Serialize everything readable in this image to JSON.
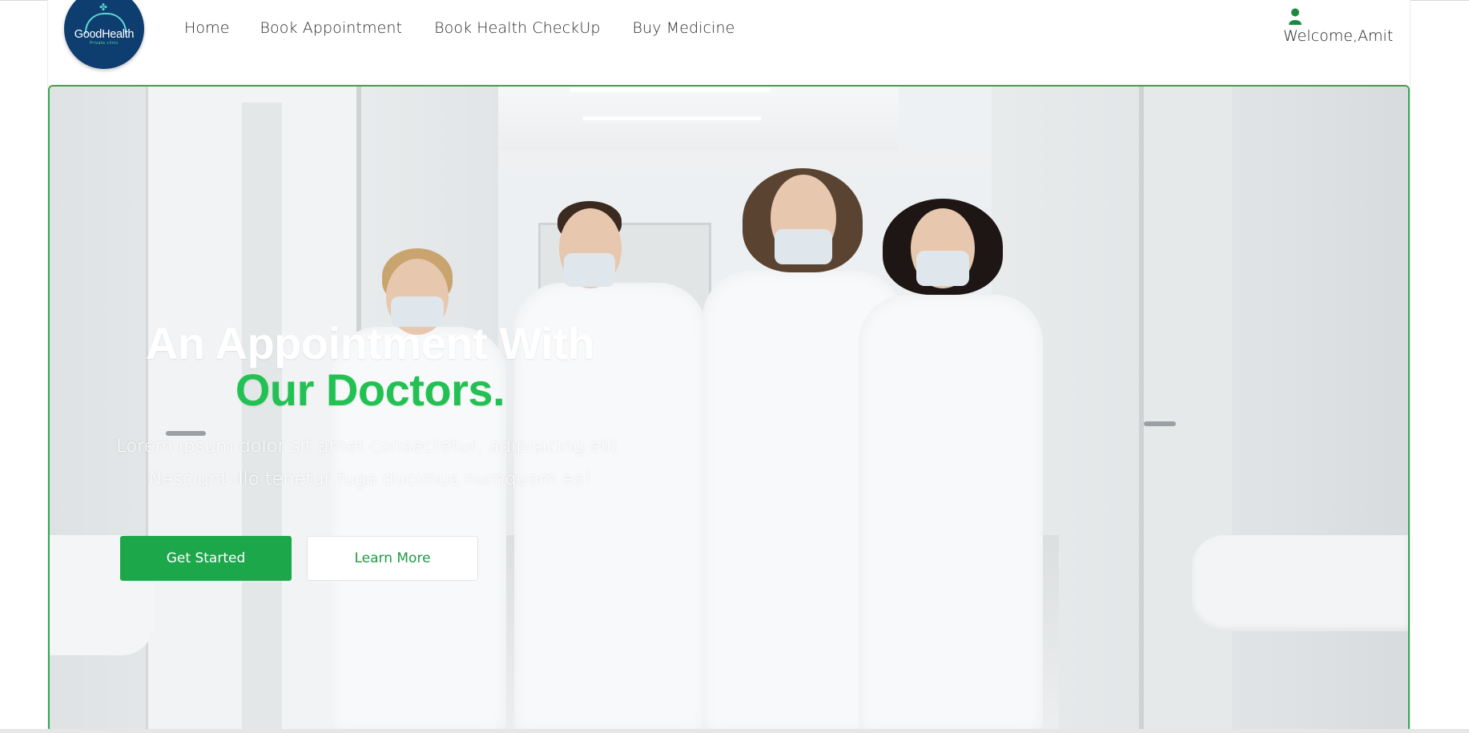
{
  "brand": {
    "name": "GoodHealth",
    "tagline": "Private clinic",
    "colors": {
      "navy": "#0e3d70",
      "accent": "#1ba74a",
      "highlight": "#23c153"
    }
  },
  "nav": {
    "items": [
      {
        "label": "Home"
      },
      {
        "label": "Book Appointment"
      },
      {
        "label": "Book Health CheckUp"
      },
      {
        "label": "Buy Medicine"
      }
    ]
  },
  "user": {
    "icon": "user-icon",
    "welcome": "Welcome,Amit"
  },
  "hero": {
    "title_line1": "An Appointment With",
    "title_line2": "Our Doctors.",
    "subtitle": "Lorem ipsum dolor sit amet consectetur, adipisicing elit. Nesciunt illo tenetur fuga ducimus numquam ea!",
    "primary_button": "Get Started",
    "secondary_button": "Learn More"
  }
}
